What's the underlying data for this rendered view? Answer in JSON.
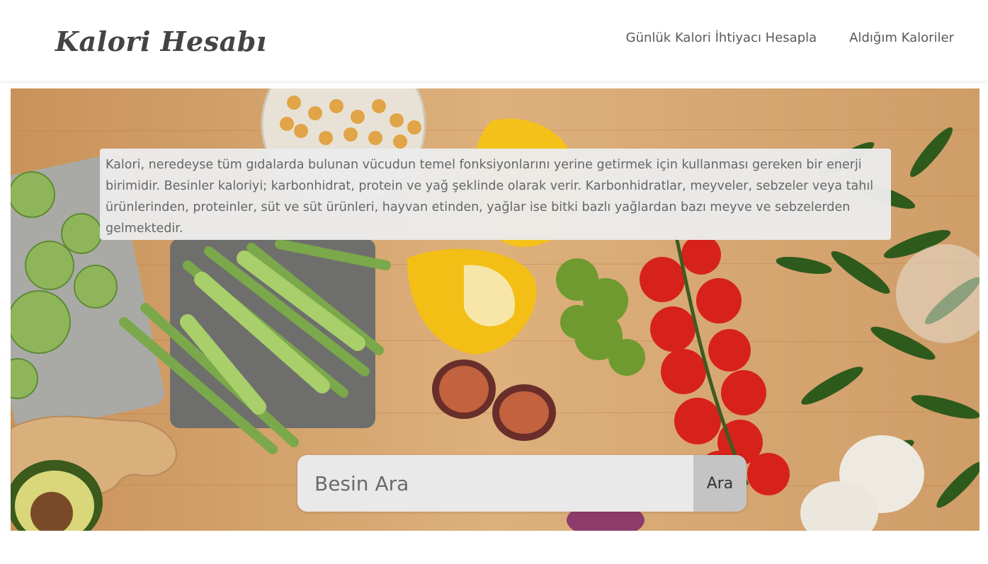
{
  "header": {
    "brand": "Kalori Hesabı",
    "nav": [
      {
        "label": "Günlük Kalori İhtiyacı Hesapla"
      },
      {
        "label": "Aldığım Kaloriler"
      }
    ]
  },
  "hero": {
    "info_text": "Kalori, neredeyse tüm gıdalarda bulunan vücudun temel fonksiyonlarını yerine getirmek için kullanması gereken bir enerji birimidir. Besinler kaloriyi; karbonhidrat, protein ve yağ şeklinde olarak verir. Karbonhidratlar, meyveler, sebzeler veya tahıl ürünlerinden, proteinler, süt ve süt ürünleri, hayvan etinden, yağlar ise bitki bazlı yağlardan bazı meyve ve sebzelerden gelmektedir.",
    "search": {
      "placeholder": "Besin Ara",
      "value": "",
      "button_label": "Ara"
    }
  }
}
